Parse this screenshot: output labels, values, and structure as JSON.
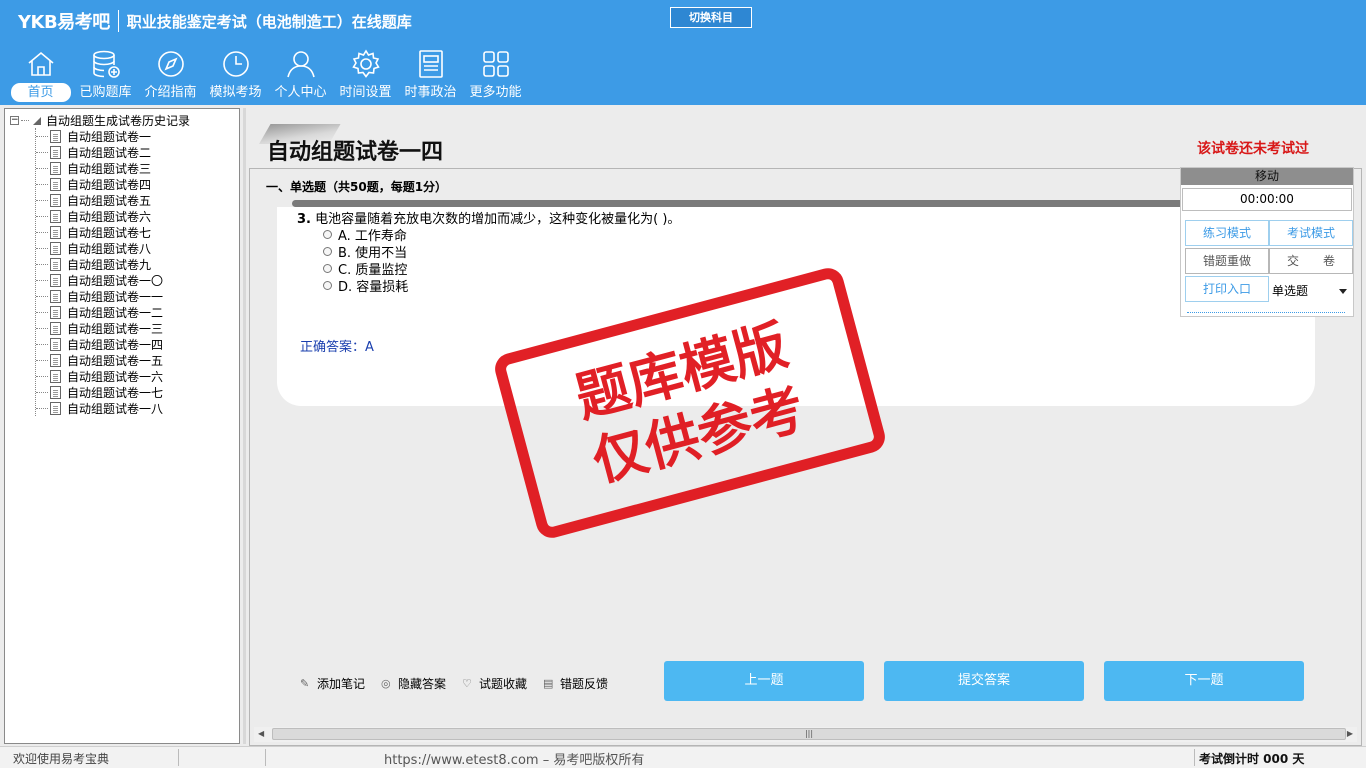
{
  "header": {
    "logo": "YKB易考吧",
    "title": "职业技能鉴定考试（电池制造工）在线题库",
    "switch_label": "切换科目"
  },
  "nav": [
    {
      "label": "首页",
      "icon": "home-icon"
    },
    {
      "label": "已购题库",
      "icon": "database-icon"
    },
    {
      "label": "介绍指南",
      "icon": "compass-icon"
    },
    {
      "label": "模拟考场",
      "icon": "clock-icon"
    },
    {
      "label": "个人中心",
      "icon": "user-icon"
    },
    {
      "label": "时间设置",
      "icon": "gear-icon"
    },
    {
      "label": "时事政治",
      "icon": "newspaper-icon"
    },
    {
      "label": "更多功能",
      "icon": "grid-icon"
    }
  ],
  "sidebar": {
    "root_label": "自动组题生成试卷历史记录",
    "items": [
      "自动组题试卷一",
      "自动组题试卷二",
      "自动组题试卷三",
      "自动组题试卷四",
      "自动组题试卷五",
      "自动组题试卷六",
      "自动组题试卷七",
      "自动组题试卷八",
      "自动组题试卷九",
      "自动组题试卷一〇",
      "自动组题试卷一一",
      "自动组题试卷一二",
      "自动组题试卷一三",
      "自动组题试卷一四",
      "自动组题试卷一五",
      "自动组题试卷一六",
      "自动组题试卷一七",
      "自动组题试卷一八"
    ]
  },
  "main": {
    "paper_title": "自动组题试卷一四",
    "not_taken": "该试卷还未考试过",
    "section": "一、单选题（共50题，每题1分）",
    "question": {
      "number": "3.",
      "text": "电池容量随着充放电次数的增加而减少，这种变化被量化为( )。",
      "options": [
        "A. 工作寿命",
        "B. 使用不当",
        "C. 质量监控",
        "D. 容量损耗"
      ],
      "answer": "正确答案：A"
    },
    "tools": [
      {
        "label": "添加笔记",
        "icon": "pencil-icon"
      },
      {
        "label": "隐藏答案",
        "icon": "eye-icon"
      },
      {
        "label": "试题收藏",
        "icon": "heart-icon"
      },
      {
        "label": "错题反馈",
        "icon": "feedback-icon"
      }
    ],
    "buttons": {
      "prev": "上一题",
      "submit": "提交答案",
      "next": "下一题"
    },
    "stamp_line1": "题库模版",
    "stamp_line2": "仅供参考"
  },
  "panel": {
    "move": "移动",
    "timer": "00:00:00",
    "practice": "练习模式",
    "exam": "考试模式",
    "redo": "错题重做",
    "hand_in": "交　　卷",
    "print": "打印入口",
    "type_select": "单选题"
  },
  "status": {
    "welcome": "欢迎使用易考宝典",
    "copyright": "https://www.etest8.com – 易考吧版权所有",
    "countdown": "考试倒计时 000 天"
  }
}
